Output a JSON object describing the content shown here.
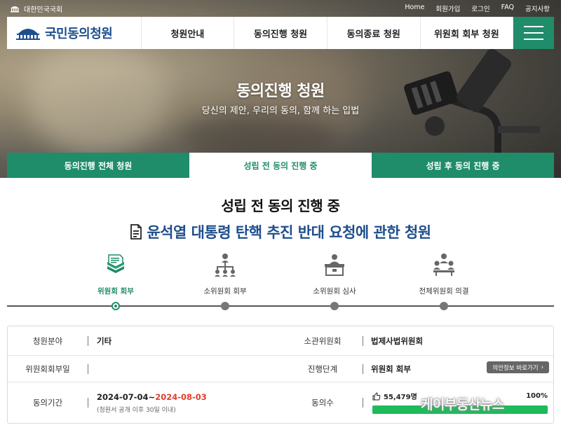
{
  "topbar": {
    "org": "대한민국국회",
    "links": [
      "Home",
      "회원가입",
      "로그인",
      "FAQ",
      "공지사항"
    ]
  },
  "nav": {
    "logo": "국민동의청원",
    "items": [
      "청원안내",
      "동의진행 청원",
      "동의종료 청원",
      "위원회 회부 청원"
    ]
  },
  "hero": {
    "title": "동의진행 청원",
    "subtitle": "당신의 제안, 우리의 동의, 함께 하는 입법"
  },
  "tabs": [
    {
      "label": "동의진행 전체 청원",
      "active": false
    },
    {
      "label": "성립 전 동의 진행 중",
      "active": true
    },
    {
      "label": "성립 후 동의 진행 중",
      "active": false
    }
  ],
  "section_title": "성립 전 동의 진행 중",
  "petition_title": "윤석열 대통령 탄핵 추진 반대 요청에 관한 청원",
  "steps": [
    {
      "label": "위원회 회부",
      "current": true,
      "icon": "documents-icon"
    },
    {
      "label": "소위원회 회부",
      "current": false,
      "icon": "org-chart-icon"
    },
    {
      "label": "소위원회 심사",
      "current": false,
      "icon": "podium-icon"
    },
    {
      "label": "전체위원회 의결",
      "current": false,
      "icon": "meeting-icon"
    }
  ],
  "info": {
    "field_label": "청원분야",
    "field_value": "기타",
    "committee_label": "소관위원회",
    "committee_value": "법제사법위원회",
    "referral_date_label": "위원회회부일",
    "referral_date_value": "",
    "stage_label": "진행단계",
    "stage_value": "위원회 회부",
    "bill_info_button": "의안정보 바로가기",
    "period_label": "동의기간",
    "period_start": "2024-07-04~",
    "period_end": "2024-08-03",
    "period_note": "(청원서 공개 이후 30일 이내)",
    "agree_label": "동의수",
    "agree_count": "55,479명",
    "agree_percent_label": "100%",
    "agree_percent": 100
  },
  "watermark": "케이부동산뉴스",
  "colors": {
    "primary_green": "#1f8c6a",
    "title_blue": "#1e4e8c",
    "end_date_red": "#e23c2d",
    "progress_green": "#1fba5a"
  }
}
